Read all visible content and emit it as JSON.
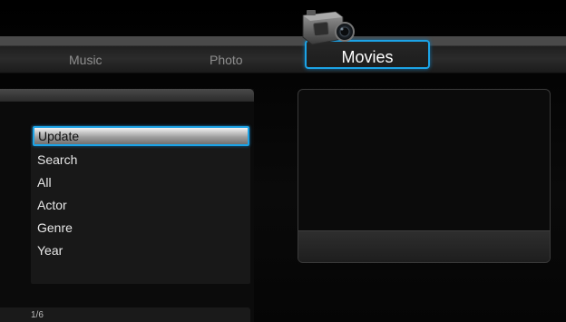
{
  "tabs": {
    "music": "Music",
    "photo": "Photo",
    "movies": "Movies"
  },
  "menu": {
    "items": [
      "Update",
      "Search",
      "All",
      "Actor",
      "Genre",
      "Year"
    ],
    "selected": "Update"
  },
  "page_indicator": "1/6",
  "colors": {
    "highlight": "#1ca3e6",
    "background": "#000000"
  },
  "icons": {
    "active_tab": "camcorder-icon"
  }
}
